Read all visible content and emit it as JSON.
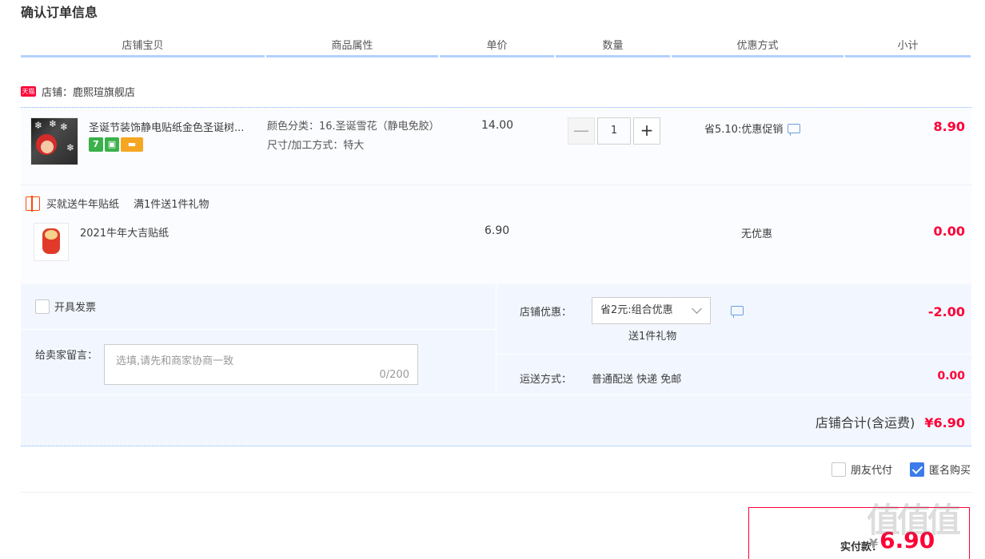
{
  "page": {
    "title": "确认订单信息"
  },
  "table_headers": [
    "店铺宝贝",
    "商品属性",
    "单价",
    "数量",
    "优惠方式",
    "小计"
  ],
  "shop": {
    "badge": "天猫",
    "label": "店铺：鹿熙瑄旗舰店"
  },
  "item": {
    "title": "圣诞节装饰静电贴纸金色圣诞树...",
    "badges": [
      "7",
      "mobile",
      "card"
    ],
    "attr_color": "颜色分类：16.圣诞雪花（静电免胶）",
    "attr_size": "尺寸/加工方式：特大",
    "unit_price": "14.00",
    "quantity": "1",
    "minus": "—",
    "plus": "+",
    "promo": "省5.10:优惠促销",
    "subtotal": "8.90"
  },
  "gift": {
    "promo_title": "买就送牛年贴纸",
    "promo_rule": "满1件送1件礼物",
    "title": "2021牛年大吉贴纸",
    "price": "6.90",
    "promo": "无优惠",
    "subtotal": "0.00"
  },
  "extras": {
    "invoice_label": "开具发票",
    "message_label": "给卖家留言：",
    "message_placeholder": "选填,请先和商家协商一致",
    "message_count": "0/200",
    "coupon_label": "店铺优惠：",
    "coupon_value": "省2元:组合优惠",
    "coupon_note": "送1件礼物",
    "coupon_amount": "-2.00",
    "shipping_label": "运送方式：",
    "shipping_value": "普通配送 快递 免邮",
    "shipping_amount": "0.00",
    "shop_total_label": "店铺合计(含运费)",
    "shop_total_amount": "¥6.90"
  },
  "options": {
    "friend_pay": "朋友代付",
    "anonymous": "匿名购买",
    "anonymous_checked": true
  },
  "payment": {
    "label": "实付款：",
    "currency": "¥",
    "amount": "6.90"
  },
  "watermark": "值值值",
  "colors": {
    "accent": "#ff0036",
    "header_line": "#b2d1ff",
    "panel_bg": "#f2f7ff",
    "checkbox": "#3b7bea"
  }
}
